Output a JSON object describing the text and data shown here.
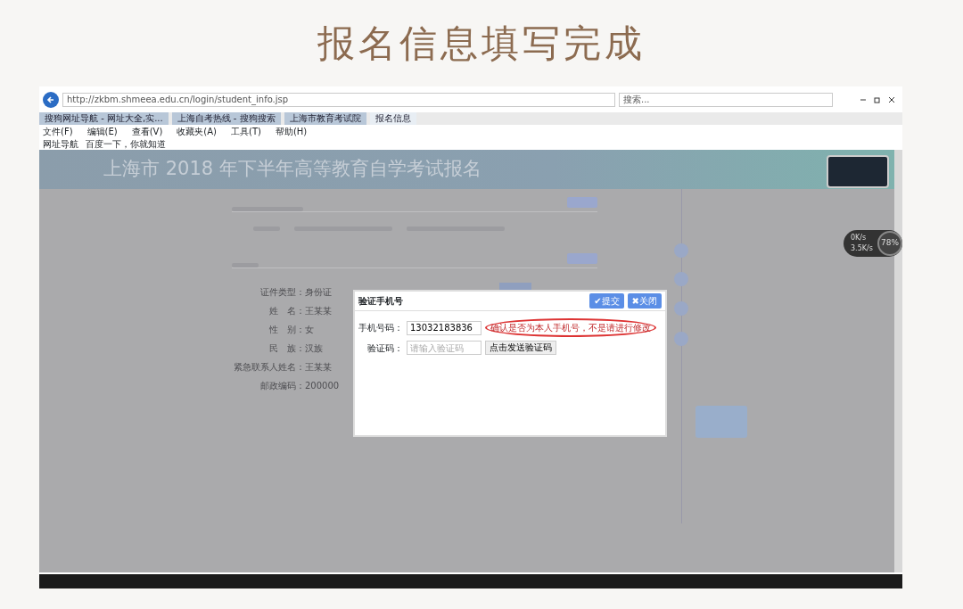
{
  "slide_title": "报名信息填写完成",
  "browser": {
    "url": "http://zkbm.shmeea.edu.cn/login/student_info.jsp",
    "search_placeholder": "搜索...",
    "tabs": [
      {
        "title": "搜狗网址导航 - 网址大全,实...",
        "selected": false
      },
      {
        "title": "上海自考热线 - 搜狗搜索",
        "selected": false
      },
      {
        "title": "上海市教育考试院",
        "selected": false
      },
      {
        "title": "报名信息",
        "selected": true
      }
    ],
    "menu": [
      "文件(F)",
      "编辑(E)",
      "查看(V)",
      "收藏夹(A)",
      "工具(T)",
      "帮助(H)"
    ],
    "favorites": [
      "网址导航",
      "百度一下，你就知道"
    ]
  },
  "page": {
    "banner": "上海市 2018 年下半年高等教育自学考试报名",
    "form_rows": [
      {
        "label": "证件类型：",
        "value": "身份证"
      },
      {
        "label": "姓　名：",
        "value": "王某某"
      },
      {
        "label": "性　别：",
        "value": "女"
      },
      {
        "label": "民　族：",
        "value": "汉族"
      },
      {
        "label": "紧急联系人姓名：",
        "value": "王某某"
      },
      {
        "label": "邮政编码：",
        "value": "200000"
      }
    ]
  },
  "dialog": {
    "title": "验证手机号",
    "buttons": [
      "✔提交",
      "✖关闭"
    ],
    "phone_label": "手机号码：",
    "phone_value": "13032183836",
    "hint": "确认是否为本人手机号，不是请进行修改",
    "code_label": "验证码：",
    "code_placeholder": "请输入验证码",
    "send_button": "点击发送验证码"
  },
  "speed_widget": {
    "upload": "0K/s",
    "download": "3.5K/s",
    "percent": "78%"
  }
}
